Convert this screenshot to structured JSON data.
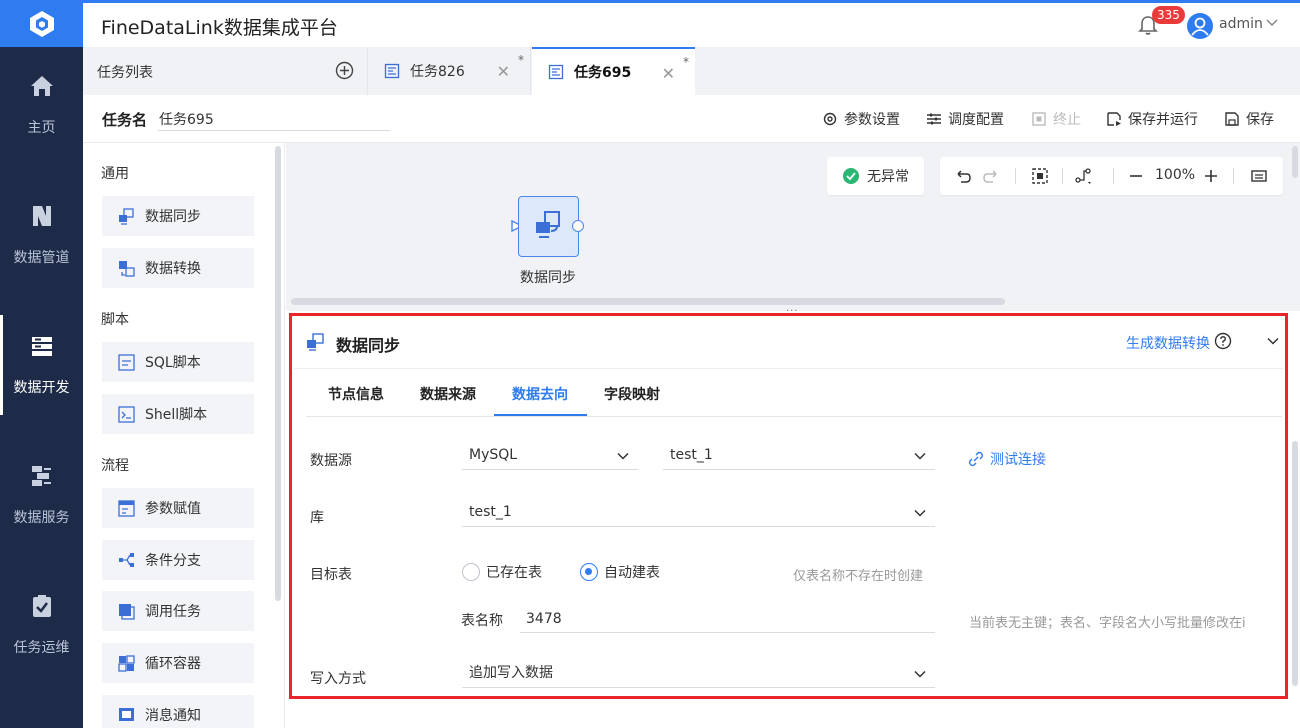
{
  "app": {
    "title": "FineDataLink数据集成平台"
  },
  "header": {
    "notification_count": "335",
    "user": "admin"
  },
  "nav": {
    "items": [
      {
        "label": "主页",
        "icon": "home-icon"
      },
      {
        "label": "数据管道",
        "icon": "pipeline-icon"
      },
      {
        "label": "数据开发",
        "icon": "data-dev-icon",
        "active": true
      },
      {
        "label": "数据服务",
        "icon": "data-service-icon"
      },
      {
        "label": "任务运维",
        "icon": "task-ops-icon"
      }
    ]
  },
  "tabs": {
    "task_list_label": "任务列表",
    "items": [
      {
        "label": "任务826",
        "modified": "*"
      },
      {
        "label": "任务695",
        "modified": "*",
        "active": true
      }
    ]
  },
  "task": {
    "name_label": "任务名",
    "name_value": "任务695",
    "tools": {
      "params": "参数设置",
      "schedule": "调度配置",
      "stop": "终止",
      "save_run": "保存并运行",
      "save": "保存"
    }
  },
  "palette": {
    "groups": [
      {
        "title": "通用",
        "items": [
          "数据同步",
          "数据转换"
        ]
      },
      {
        "title": "脚本",
        "items": [
          "SQL脚本",
          "Shell脚本"
        ]
      },
      {
        "title": "流程",
        "items": [
          "参数赋值",
          "条件分支",
          "调用任务",
          "循环容器",
          "消息通知"
        ]
      }
    ]
  },
  "canvas": {
    "status": "无异常",
    "zoom": "100%",
    "node_label": "数据同步",
    "resize_handle": "..."
  },
  "panel": {
    "title": "数据同步",
    "generate_link": "生成数据转换",
    "tabs": [
      "节点信息",
      "数据来源",
      "数据去向",
      "字段映射"
    ],
    "active_tab": "数据去向",
    "form": {
      "datasource_label": "数据源",
      "datasource_type": "MySQL",
      "datasource_conn": "test_1",
      "test_connection": "测试连接",
      "db_label": "库",
      "db_value": "test_1",
      "target_label": "目标表",
      "radio_existing": "已存在表",
      "radio_auto": "自动建表",
      "auto_hint": "仅表名称不存在时创建",
      "table_name_label": "表名称",
      "table_name_value": "3478",
      "table_name_hint": "当前表无主键；表名、字段名大小写批量修改在i",
      "write_label": "写入方式",
      "write_value": "追加写入数据"
    }
  },
  "colors": {
    "accent": "#2f7cf0",
    "nav_bg": "#1e2b48",
    "highlight": "#e8242d"
  }
}
